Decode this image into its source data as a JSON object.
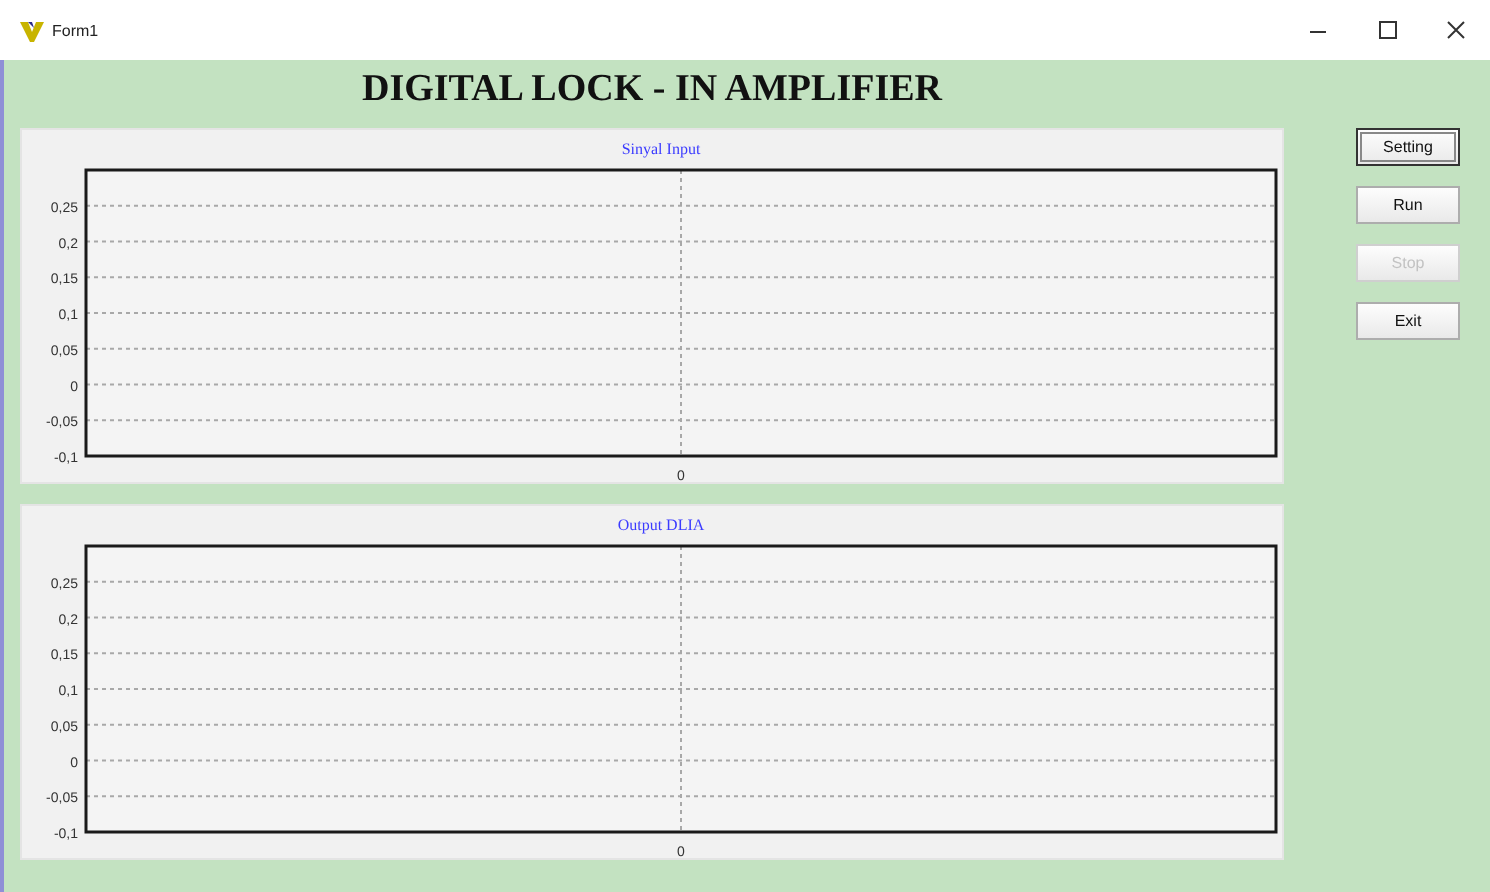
{
  "window": {
    "title": "Form1"
  },
  "heading": "DIGITAL LOCK - IN AMPLIFIER",
  "plots": [
    {
      "title": "Sinyal Input",
      "y_axis_labels": [
        "0,25",
        "0,2",
        "0,15",
        "0,1",
        "0,05",
        "0",
        "-0,05",
        "-0,1"
      ],
      "x_axis_label": "0"
    },
    {
      "title": "Output DLIA",
      "y_axis_labels": [
        "0,25",
        "0,2",
        "0,15",
        "0,1",
        "0,05",
        "0",
        "-0,05",
        "-0,1"
      ],
      "x_axis_label": "0"
    }
  ],
  "buttons": [
    {
      "label": "Setting",
      "disabled": false,
      "selected": true
    },
    {
      "label": "Run",
      "disabled": false,
      "selected": false
    },
    {
      "label": "Stop",
      "disabled": true,
      "selected": false
    },
    {
      "label": "Exit",
      "disabled": false,
      "selected": false
    }
  ]
}
